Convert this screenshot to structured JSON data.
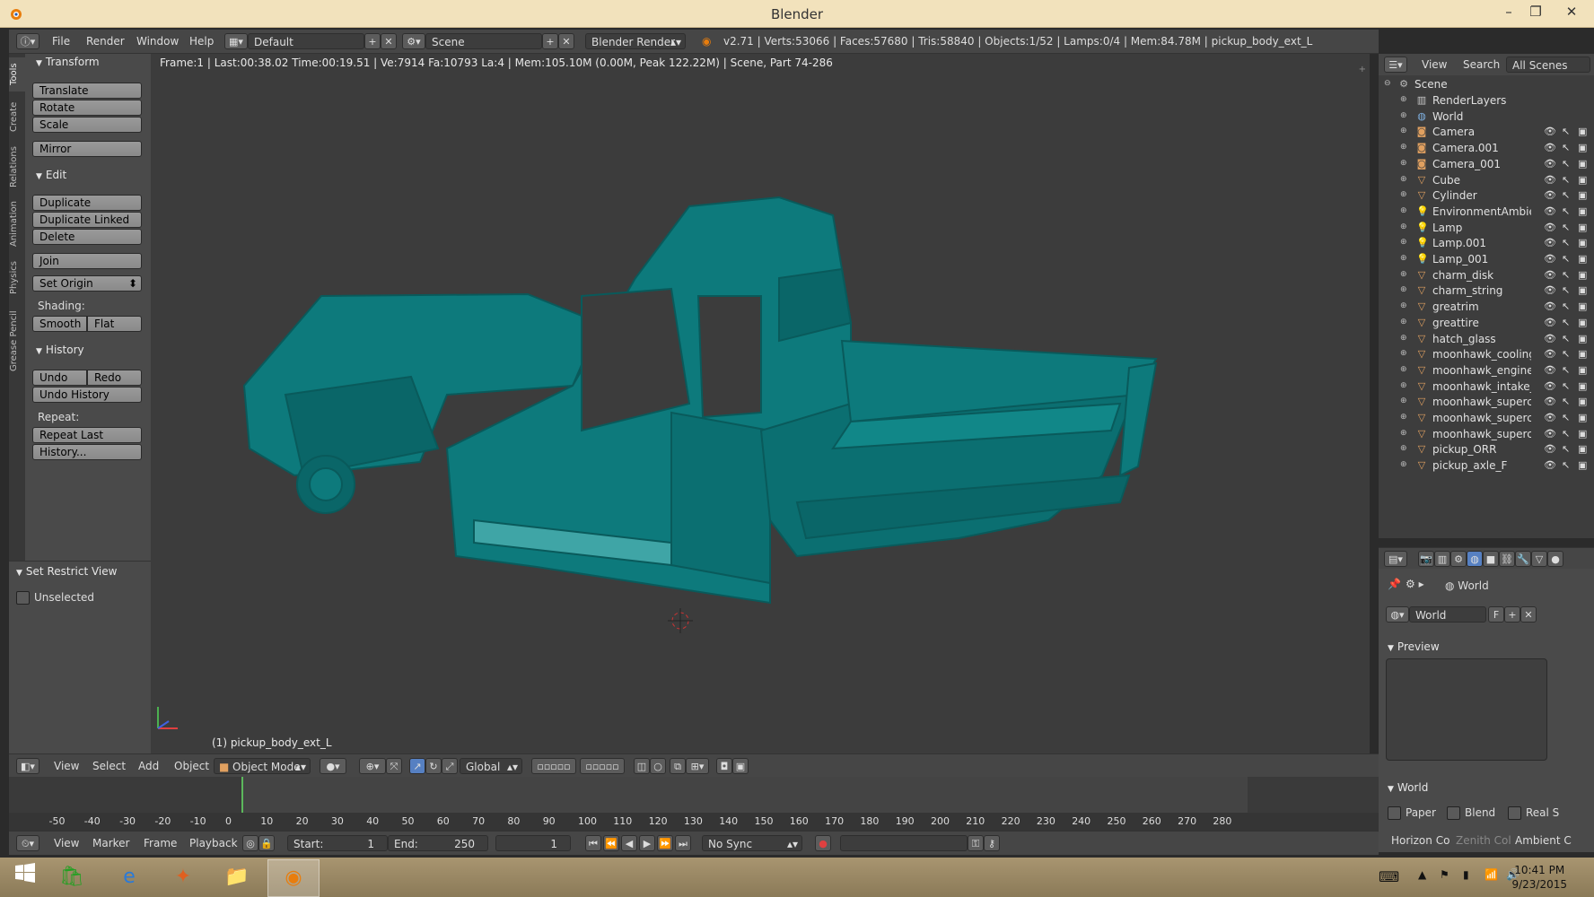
{
  "window": {
    "title": "Blender"
  },
  "info_header": {
    "menus": [
      "File",
      "Render",
      "Window",
      "Help"
    ],
    "layout": "Default",
    "scene": "Scene",
    "engine": "Blender Render",
    "stats": "v2.71 | Verts:53066 | Faces:57680 | Tris:58840 | Objects:1/52 | Lamps:0/4 | Mem:84.78M | pickup_body_ext_L"
  },
  "tool_tabs": [
    "Tools",
    "Create",
    "Relations",
    "Animation",
    "Physics",
    "Grease Pencil"
  ],
  "tool_shelf": {
    "transform": {
      "title": "Transform",
      "buttons": [
        "Translate",
        "Rotate",
        "Scale",
        "Mirror"
      ]
    },
    "edit": {
      "title": "Edit",
      "buttons": [
        "Duplicate",
        "Duplicate Linked",
        "Delete",
        "Join",
        "Set Origin"
      ],
      "shading_label": "Shading:",
      "smooth": "Smooth",
      "flat": "Flat"
    },
    "history": {
      "title": "History",
      "undo": "Undo",
      "redo": "Redo",
      "undo_history": "Undo History",
      "repeat_label": "Repeat:",
      "repeat_last": "Repeat Last",
      "history": "History..."
    },
    "restrict": {
      "title": "Set Restrict View",
      "unselected": "Unselected"
    }
  },
  "viewport": {
    "info": "Frame:1 | Last:00:38.02 Time:00:19.51 | Ve:7914 Fa:10793 La:4 | Mem:105.10M (0.00M, Peak 122.22M) | Scene, Part 74-286",
    "object_label": "(1) pickup_body_ext_L",
    "model_color": "#0d7a7c"
  },
  "view3d_header": {
    "menus": [
      "View",
      "Select",
      "Add",
      "Object"
    ],
    "mode": "Object Mode",
    "orientation": "Global"
  },
  "timeline": {
    "ticks": [
      "-50",
      "-40",
      "-30",
      "-20",
      "-10",
      "0",
      "10",
      "20",
      "30",
      "40",
      "50",
      "60",
      "70",
      "80",
      "90",
      "100",
      "110",
      "120",
      "130",
      "140",
      "150",
      "160",
      "170",
      "180",
      "190",
      "200",
      "210",
      "220",
      "230",
      "240",
      "250",
      "260",
      "270",
      "280"
    ],
    "menus": [
      "View",
      "Marker",
      "Frame",
      "Playback"
    ],
    "start_label": "Start:",
    "start": "1",
    "end_label": "End:",
    "end": "250",
    "current": "1",
    "sync": "No Sync"
  },
  "outliner": {
    "menus": [
      "View",
      "Search"
    ],
    "filter": "All Scenes",
    "scene": "Scene",
    "items": [
      {
        "name": "RenderLayers",
        "icon": "render-layers-icon",
        "color": "#c8c8c8"
      },
      {
        "name": "World",
        "icon": "world-icon",
        "color": "#7fb0e0"
      },
      {
        "name": "Camera",
        "icon": "camera-icon",
        "color": "#e0a060"
      },
      {
        "name": "Camera.001",
        "icon": "camera-icon",
        "color": "#e0a060"
      },
      {
        "name": "Camera_001",
        "icon": "camera-icon",
        "color": "#e0a060"
      },
      {
        "name": "Cube",
        "icon": "mesh-icon",
        "color": "#e0a060"
      },
      {
        "name": "Cylinder",
        "icon": "mesh-icon",
        "color": "#e0a060"
      },
      {
        "name": "EnvironmentAmbie",
        "icon": "lamp-icon",
        "color": "#e0c060"
      },
      {
        "name": "Lamp",
        "icon": "lamp-icon",
        "color": "#e0c060"
      },
      {
        "name": "Lamp.001",
        "icon": "lamp-icon",
        "color": "#e0c060"
      },
      {
        "name": "Lamp_001",
        "icon": "lamp-icon",
        "color": "#e0c060"
      },
      {
        "name": "charm_disk",
        "icon": "mesh-icon",
        "color": "#e0a060"
      },
      {
        "name": "charm_string",
        "icon": "mesh-icon",
        "color": "#e0a060"
      },
      {
        "name": "greatrim",
        "icon": "mesh-icon",
        "color": "#e0a060"
      },
      {
        "name": "greattire",
        "icon": "mesh-icon",
        "color": "#e0a060"
      },
      {
        "name": "hatch_glass",
        "icon": "mesh-icon",
        "color": "#e0a060"
      },
      {
        "name": "moonhawk_cooling",
        "icon": "mesh-icon",
        "color": "#e0a060"
      },
      {
        "name": "moonhawk_engine",
        "icon": "mesh-icon",
        "color": "#e0a060"
      },
      {
        "name": "moonhawk_intake_",
        "icon": "mesh-icon",
        "color": "#e0a060"
      },
      {
        "name": "moonhawk_superch",
        "icon": "mesh-icon",
        "color": "#e0a060"
      },
      {
        "name": "moonhawk_superch",
        "icon": "mesh-icon",
        "color": "#e0a060"
      },
      {
        "name": "moonhawk_superch",
        "icon": "mesh-icon",
        "color": "#e0a060"
      },
      {
        "name": "pickup_ORR",
        "icon": "mesh-icon",
        "color": "#e0a060"
      },
      {
        "name": "pickup_axle_F",
        "icon": "mesh-icon",
        "color": "#e0a060"
      }
    ]
  },
  "properties": {
    "breadcrumb": "World",
    "world_field": "World",
    "fake_user": "F",
    "preview_title": "Preview",
    "world_title": "World",
    "paper": "Paper",
    "blend": "Blend",
    "real_sky": "Real S",
    "horizon": "Horizon Co",
    "zenith": "Zenith Col",
    "ambient": "Ambient C"
  },
  "taskbar": {
    "time": "10:41 PM",
    "date": "9/23/2015"
  }
}
